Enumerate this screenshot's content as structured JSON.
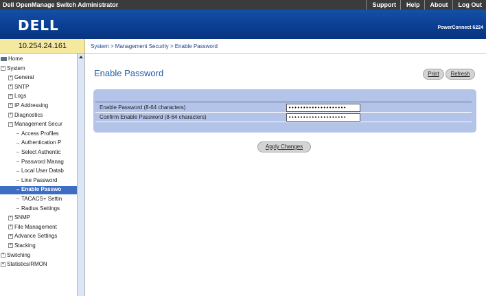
{
  "topbar": {
    "app_title": "Dell OpenManage Switch Administrator",
    "links": [
      "Support",
      "Help",
      "About",
      "Log Out"
    ]
  },
  "banner": {
    "logo": "DELL",
    "product": "PowerConnect 6224"
  },
  "ip_address": "10.254.24.161",
  "breadcrumb": "System > Management Security > Enable Password",
  "sidebar": {
    "items": [
      {
        "label": "Home",
        "kind": "home"
      },
      {
        "label": "System",
        "kind": "minus"
      },
      {
        "label": "General",
        "kind": "plus"
      },
      {
        "label": "SNTP",
        "kind": "plus"
      },
      {
        "label": "Logs",
        "kind": "plus"
      },
      {
        "label": "IP Addressing",
        "kind": "plus"
      },
      {
        "label": "Diagnostics",
        "kind": "plus"
      },
      {
        "label": "Management Secur",
        "kind": "minus"
      },
      {
        "label": "Access Profiles",
        "kind": "leaf"
      },
      {
        "label": "Authentication P",
        "kind": "leaf"
      },
      {
        "label": "Select Authentic",
        "kind": "leaf"
      },
      {
        "label": "Password Manag",
        "kind": "leaf"
      },
      {
        "label": "Local User Datab",
        "kind": "leaf"
      },
      {
        "label": "Line Password",
        "kind": "leaf"
      },
      {
        "label": "Enable Passwo",
        "kind": "leaf",
        "selected": true
      },
      {
        "label": "TACACS+ Settin",
        "kind": "leaf"
      },
      {
        "label": "Radius Settings",
        "kind": "leaf"
      },
      {
        "label": "SNMP",
        "kind": "plus"
      },
      {
        "label": "File Management",
        "kind": "plus"
      },
      {
        "label": "Advance Settings",
        "kind": "plus"
      },
      {
        "label": "Stacking",
        "kind": "plus"
      },
      {
        "label": "Switching",
        "kind": "plus"
      },
      {
        "label": "Statistics/RMON",
        "kind": "plus"
      }
    ]
  },
  "main": {
    "title": "Enable Password",
    "print_label": "Print",
    "refresh_label": "Refresh",
    "apply_label": "Apply Changes",
    "fields": [
      {
        "label": "Enable Password (8-64 characters)",
        "value": "••••••••••••••••••••"
      },
      {
        "label": "Confirm Enable Password (8-64 characters)",
        "value": "••••••••••••••••••••"
      }
    ]
  },
  "colors": {
    "banner": "#0a3d91",
    "accent": "#1e5aa8",
    "panel": "#b4c3e8",
    "ipbar": "#f5e9a0",
    "selected": "#3d6ec4"
  }
}
